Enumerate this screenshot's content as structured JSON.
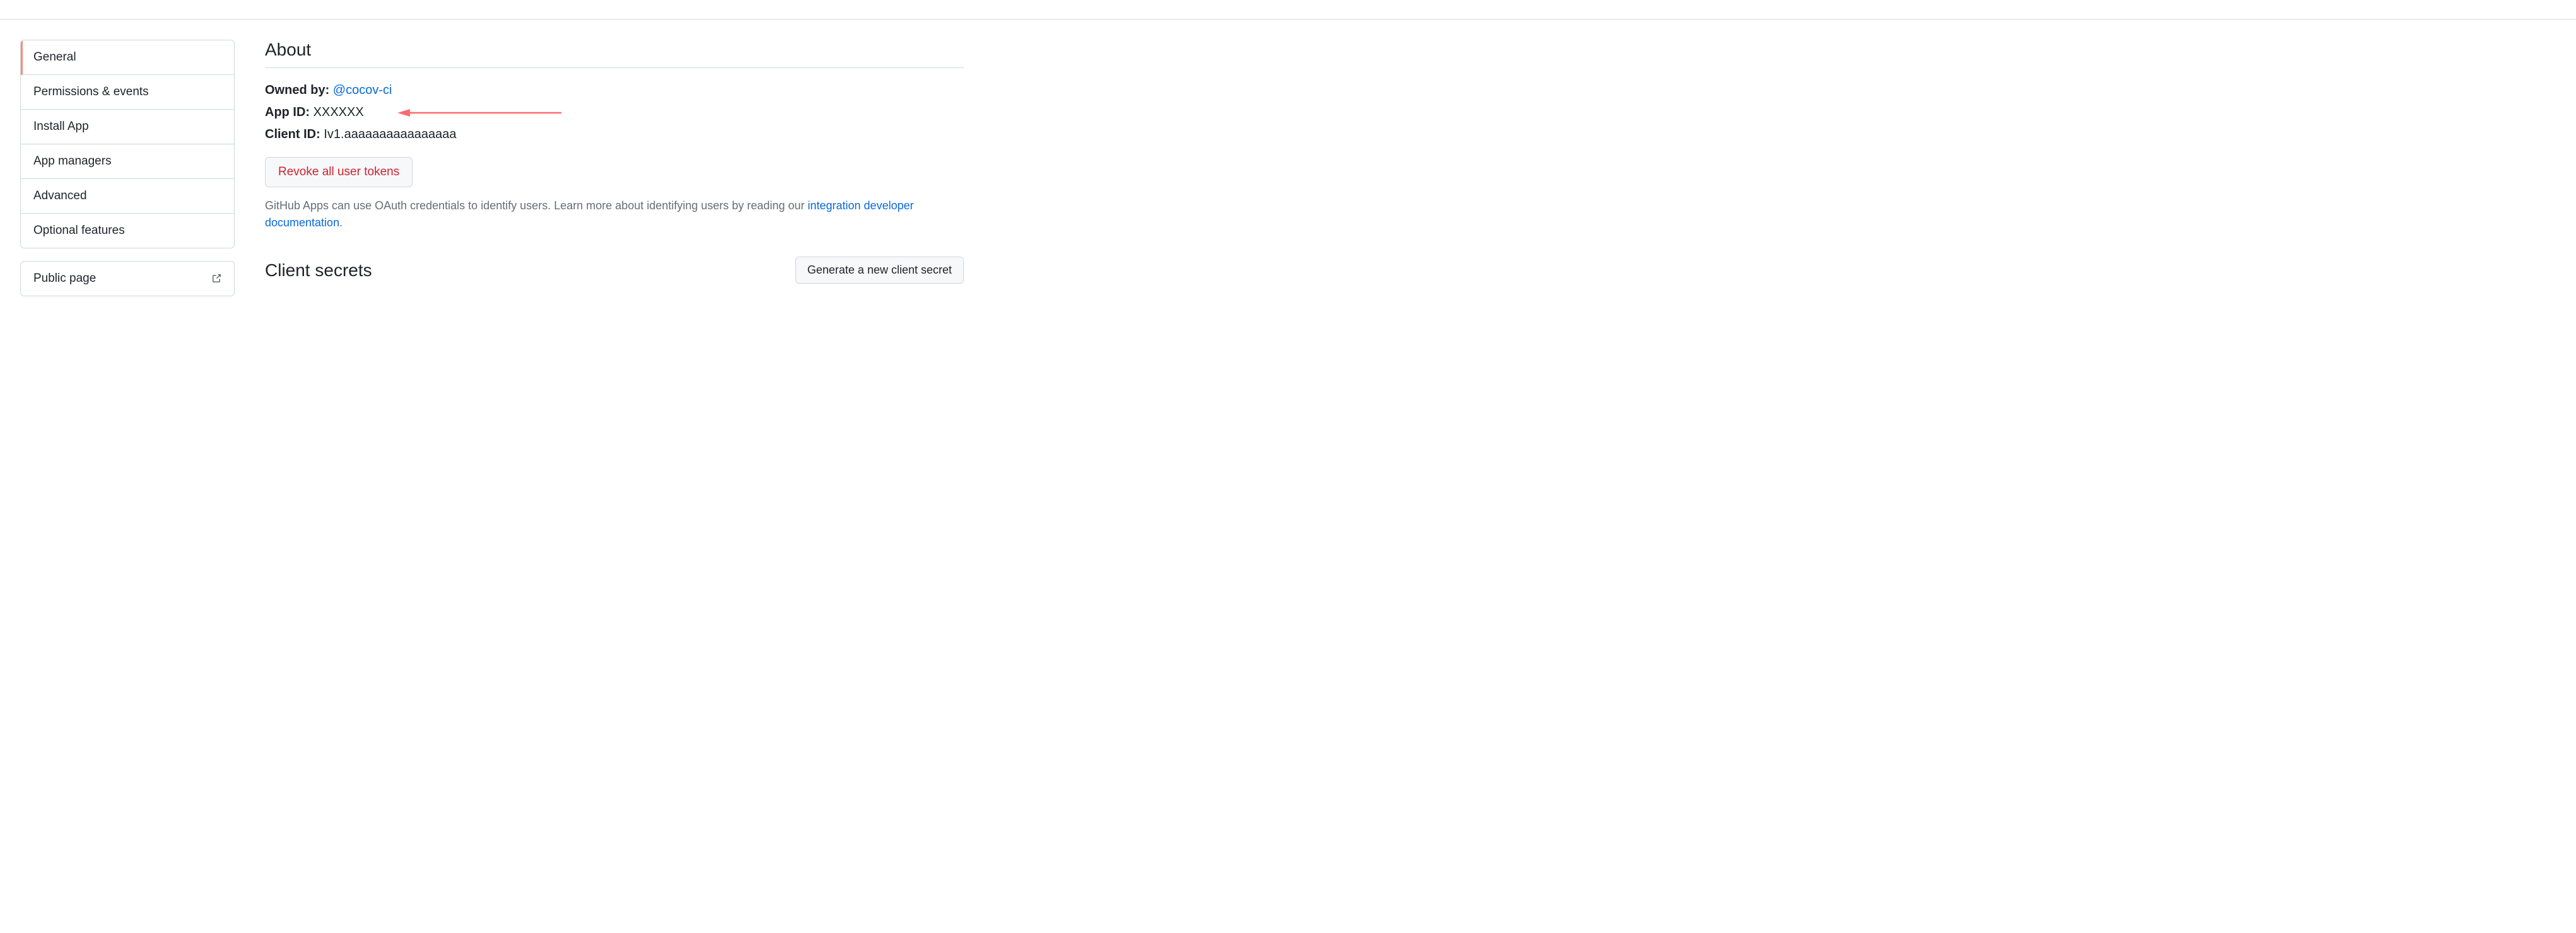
{
  "sidebar": {
    "items": [
      {
        "label": "General",
        "active": true
      },
      {
        "label": "Permissions & events",
        "active": false
      },
      {
        "label": "Install App",
        "active": false
      },
      {
        "label": "App managers",
        "active": false
      },
      {
        "label": "Advanced",
        "active": false
      },
      {
        "label": "Optional features",
        "active": false
      }
    ],
    "public_page": "Public page"
  },
  "about": {
    "heading": "About",
    "owned_by_label": "Owned by:",
    "owned_by_value": "@cocov-ci",
    "app_id_label": "App ID:",
    "app_id_value": "XXXXXX",
    "client_id_label": "Client ID:",
    "client_id_value": "Iv1.aaaaaaaaaaaaaaaa",
    "revoke_button": "Revoke all user tokens",
    "help_text_prefix": "GitHub Apps can use OAuth credentials to identify users. Learn more about identifying users by reading our ",
    "help_text_link": "integration developer documentation",
    "help_text_suffix": "."
  },
  "client_secrets": {
    "heading": "Client secrets",
    "generate_button": "Generate a new client secret"
  }
}
